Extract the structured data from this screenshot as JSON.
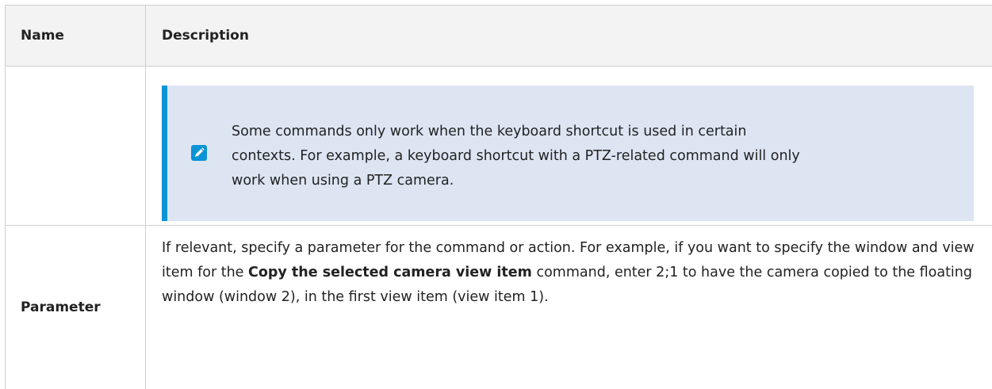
{
  "table": {
    "headers": {
      "name": "Name",
      "description": "Description"
    },
    "note": {
      "icon": "pencil-icon",
      "text": "Some commands only work when the keyboard shortcut is used in certain contexts. For example, a keyboard shortcut with a PTZ-related command will only work when using a PTZ camera."
    },
    "parameter_row": {
      "name": "Parameter",
      "desc_before": "If relevant, specify a parameter for the command or action. For example, if you want to specify the window and view item for the ",
      "desc_bold": "Copy the selected camera view item",
      "desc_after": " command, enter 2;1 to have the camera copied to the floating window (window 2), in the first view item (view item 1)."
    }
  },
  "colors": {
    "note_accent": "#0a94d6",
    "note_background": "#dde5f3",
    "header_background": "#f3f3f3",
    "border": "#cfcfcf"
  }
}
